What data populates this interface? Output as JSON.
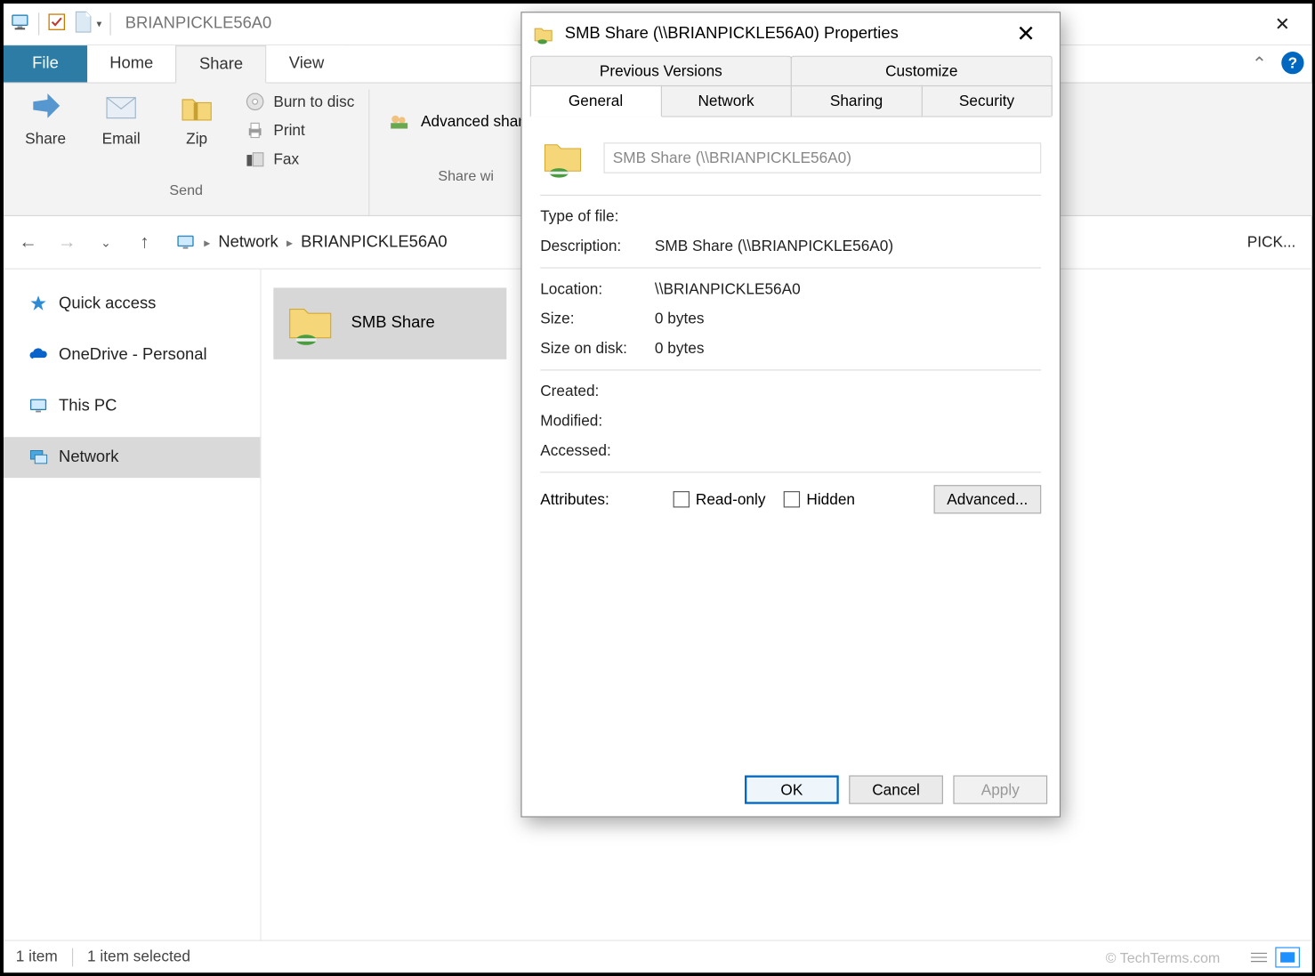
{
  "window": {
    "title": "BRIANPICKLE56A0"
  },
  "ribbon": {
    "tabs": {
      "file": "File",
      "home": "Home",
      "share": "Share",
      "view": "View"
    },
    "group_send": {
      "share": "Share",
      "email": "Email",
      "zip": "Zip",
      "burn": "Burn to disc",
      "print": "Print",
      "fax": "Fax",
      "label": "Send"
    },
    "group_sharewith": {
      "advanced": "Advanced sharing",
      "label": "Share wi"
    }
  },
  "address": {
    "network": "Network",
    "host": "BRIANPICKLE56A0",
    "search_trunc": "PICK..."
  },
  "nav": {
    "quick": "Quick access",
    "onedrive": "OneDrive - Personal",
    "thispc": "This PC",
    "network": "Network"
  },
  "content": {
    "file_name": "SMB Share"
  },
  "status": {
    "items": "1 item",
    "selected": "1 item selected",
    "watermark": "© TechTerms.com"
  },
  "dialog": {
    "title": "SMB Share (\\\\BRIANPICKLE56A0) Properties",
    "tabs": {
      "prev": "Previous Versions",
      "cust": "Customize",
      "general": "General",
      "network": "Network",
      "sharing": "Sharing",
      "security": "Security"
    },
    "name_field": "SMB Share (\\\\BRIANPICKLE56A0)",
    "labels": {
      "type": "Type of file:",
      "desc": "Description:",
      "location": "Location:",
      "size": "Size:",
      "sod": "Size on disk:",
      "created": "Created:",
      "modified": "Modified:",
      "accessed": "Accessed:",
      "attrs": "Attributes:",
      "readonly": "Read-only",
      "hidden": "Hidden",
      "advanced": "Advanced..."
    },
    "values": {
      "type": "",
      "desc": "SMB Share (\\\\BRIANPICKLE56A0)",
      "location": "\\\\BRIANPICKLE56A0",
      "size": "0 bytes",
      "sod": "0 bytes",
      "created": "",
      "modified": "",
      "accessed": ""
    },
    "buttons": {
      "ok": "OK",
      "cancel": "Cancel",
      "apply": "Apply"
    }
  }
}
